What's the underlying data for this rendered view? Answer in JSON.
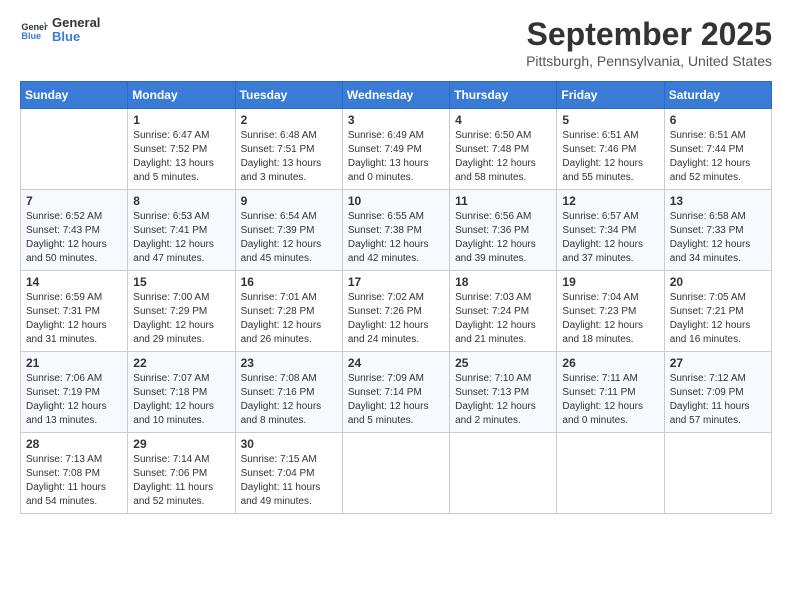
{
  "logo": {
    "general": "General",
    "blue": "Blue"
  },
  "title": "September 2025",
  "location": "Pittsburgh, Pennsylvania, United States",
  "days_of_week": [
    "Sunday",
    "Monday",
    "Tuesday",
    "Wednesday",
    "Thursday",
    "Friday",
    "Saturday"
  ],
  "weeks": [
    [
      {
        "day": "",
        "sunrise": "",
        "sunset": "",
        "daylight": ""
      },
      {
        "day": "1",
        "sunrise": "Sunrise: 6:47 AM",
        "sunset": "Sunset: 7:52 PM",
        "daylight": "Daylight: 13 hours and 5 minutes."
      },
      {
        "day": "2",
        "sunrise": "Sunrise: 6:48 AM",
        "sunset": "Sunset: 7:51 PM",
        "daylight": "Daylight: 13 hours and 3 minutes."
      },
      {
        "day": "3",
        "sunrise": "Sunrise: 6:49 AM",
        "sunset": "Sunset: 7:49 PM",
        "daylight": "Daylight: 13 hours and 0 minutes."
      },
      {
        "day": "4",
        "sunrise": "Sunrise: 6:50 AM",
        "sunset": "Sunset: 7:48 PM",
        "daylight": "Daylight: 12 hours and 58 minutes."
      },
      {
        "day": "5",
        "sunrise": "Sunrise: 6:51 AM",
        "sunset": "Sunset: 7:46 PM",
        "daylight": "Daylight: 12 hours and 55 minutes."
      },
      {
        "day": "6",
        "sunrise": "Sunrise: 6:51 AM",
        "sunset": "Sunset: 7:44 PM",
        "daylight": "Daylight: 12 hours and 52 minutes."
      }
    ],
    [
      {
        "day": "7",
        "sunrise": "Sunrise: 6:52 AM",
        "sunset": "Sunset: 7:43 PM",
        "daylight": "Daylight: 12 hours and 50 minutes."
      },
      {
        "day": "8",
        "sunrise": "Sunrise: 6:53 AM",
        "sunset": "Sunset: 7:41 PM",
        "daylight": "Daylight: 12 hours and 47 minutes."
      },
      {
        "day": "9",
        "sunrise": "Sunrise: 6:54 AM",
        "sunset": "Sunset: 7:39 PM",
        "daylight": "Daylight: 12 hours and 45 minutes."
      },
      {
        "day": "10",
        "sunrise": "Sunrise: 6:55 AM",
        "sunset": "Sunset: 7:38 PM",
        "daylight": "Daylight: 12 hours and 42 minutes."
      },
      {
        "day": "11",
        "sunrise": "Sunrise: 6:56 AM",
        "sunset": "Sunset: 7:36 PM",
        "daylight": "Daylight: 12 hours and 39 minutes."
      },
      {
        "day": "12",
        "sunrise": "Sunrise: 6:57 AM",
        "sunset": "Sunset: 7:34 PM",
        "daylight": "Daylight: 12 hours and 37 minutes."
      },
      {
        "day": "13",
        "sunrise": "Sunrise: 6:58 AM",
        "sunset": "Sunset: 7:33 PM",
        "daylight": "Daylight: 12 hours and 34 minutes."
      }
    ],
    [
      {
        "day": "14",
        "sunrise": "Sunrise: 6:59 AM",
        "sunset": "Sunset: 7:31 PM",
        "daylight": "Daylight: 12 hours and 31 minutes."
      },
      {
        "day": "15",
        "sunrise": "Sunrise: 7:00 AM",
        "sunset": "Sunset: 7:29 PM",
        "daylight": "Daylight: 12 hours and 29 minutes."
      },
      {
        "day": "16",
        "sunrise": "Sunrise: 7:01 AM",
        "sunset": "Sunset: 7:28 PM",
        "daylight": "Daylight: 12 hours and 26 minutes."
      },
      {
        "day": "17",
        "sunrise": "Sunrise: 7:02 AM",
        "sunset": "Sunset: 7:26 PM",
        "daylight": "Daylight: 12 hours and 24 minutes."
      },
      {
        "day": "18",
        "sunrise": "Sunrise: 7:03 AM",
        "sunset": "Sunset: 7:24 PM",
        "daylight": "Daylight: 12 hours and 21 minutes."
      },
      {
        "day": "19",
        "sunrise": "Sunrise: 7:04 AM",
        "sunset": "Sunset: 7:23 PM",
        "daylight": "Daylight: 12 hours and 18 minutes."
      },
      {
        "day": "20",
        "sunrise": "Sunrise: 7:05 AM",
        "sunset": "Sunset: 7:21 PM",
        "daylight": "Daylight: 12 hours and 16 minutes."
      }
    ],
    [
      {
        "day": "21",
        "sunrise": "Sunrise: 7:06 AM",
        "sunset": "Sunset: 7:19 PM",
        "daylight": "Daylight: 12 hours and 13 minutes."
      },
      {
        "day": "22",
        "sunrise": "Sunrise: 7:07 AM",
        "sunset": "Sunset: 7:18 PM",
        "daylight": "Daylight: 12 hours and 10 minutes."
      },
      {
        "day": "23",
        "sunrise": "Sunrise: 7:08 AM",
        "sunset": "Sunset: 7:16 PM",
        "daylight": "Daylight: 12 hours and 8 minutes."
      },
      {
        "day": "24",
        "sunrise": "Sunrise: 7:09 AM",
        "sunset": "Sunset: 7:14 PM",
        "daylight": "Daylight: 12 hours and 5 minutes."
      },
      {
        "day": "25",
        "sunrise": "Sunrise: 7:10 AM",
        "sunset": "Sunset: 7:13 PM",
        "daylight": "Daylight: 12 hours and 2 minutes."
      },
      {
        "day": "26",
        "sunrise": "Sunrise: 7:11 AM",
        "sunset": "Sunset: 7:11 PM",
        "daylight": "Daylight: 12 hours and 0 minutes."
      },
      {
        "day": "27",
        "sunrise": "Sunrise: 7:12 AM",
        "sunset": "Sunset: 7:09 PM",
        "daylight": "Daylight: 11 hours and 57 minutes."
      }
    ],
    [
      {
        "day": "28",
        "sunrise": "Sunrise: 7:13 AM",
        "sunset": "Sunset: 7:08 PM",
        "daylight": "Daylight: 11 hours and 54 minutes."
      },
      {
        "day": "29",
        "sunrise": "Sunrise: 7:14 AM",
        "sunset": "Sunset: 7:06 PM",
        "daylight": "Daylight: 11 hours and 52 minutes."
      },
      {
        "day": "30",
        "sunrise": "Sunrise: 7:15 AM",
        "sunset": "Sunset: 7:04 PM",
        "daylight": "Daylight: 11 hours and 49 minutes."
      },
      {
        "day": "",
        "sunrise": "",
        "sunset": "",
        "daylight": ""
      },
      {
        "day": "",
        "sunrise": "",
        "sunset": "",
        "daylight": ""
      },
      {
        "day": "",
        "sunrise": "",
        "sunset": "",
        "daylight": ""
      },
      {
        "day": "",
        "sunrise": "",
        "sunset": "",
        "daylight": ""
      }
    ]
  ]
}
